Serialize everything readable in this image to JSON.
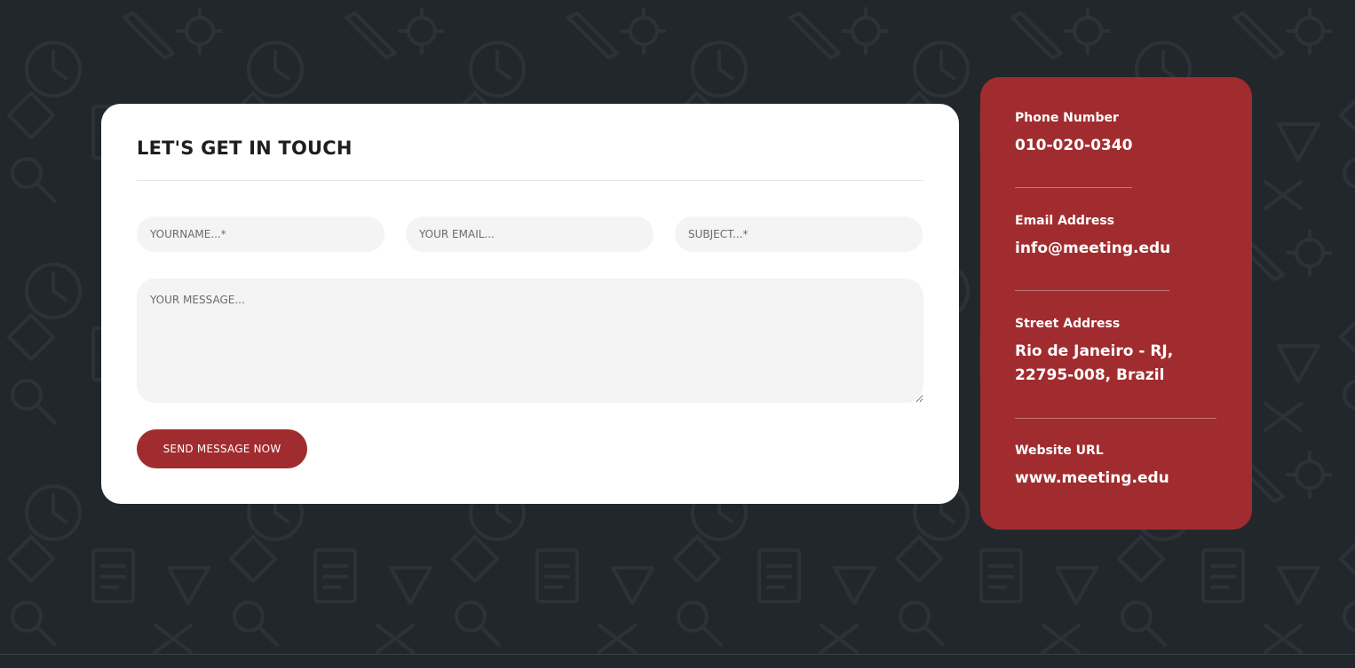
{
  "contact_form": {
    "title": "LET'S GET IN TOUCH",
    "name_placeholder": "YOURNAME...*",
    "email_placeholder": "YOUR EMAIL...",
    "subject_placeholder": "SUBJECT...*",
    "message_placeholder": "YOUR MESSAGE...",
    "submit_label": "SEND MESSAGE NOW"
  },
  "contact_info": {
    "phone_label": "Phone Number",
    "phone_value": "010-020-0340",
    "email_label": "Email Address",
    "email_value": "info@meeting.edu",
    "address_label": "Street Address",
    "address_line1": "Rio de Janeiro - RJ,",
    "address_line2": "22795-008, Brazil",
    "website_label": "Website URL",
    "website_value": "www.meeting.edu"
  },
  "colors": {
    "background": "#22272c",
    "accent": "#a12c2f",
    "card": "#ffffff",
    "field": "#f4f4f4"
  }
}
